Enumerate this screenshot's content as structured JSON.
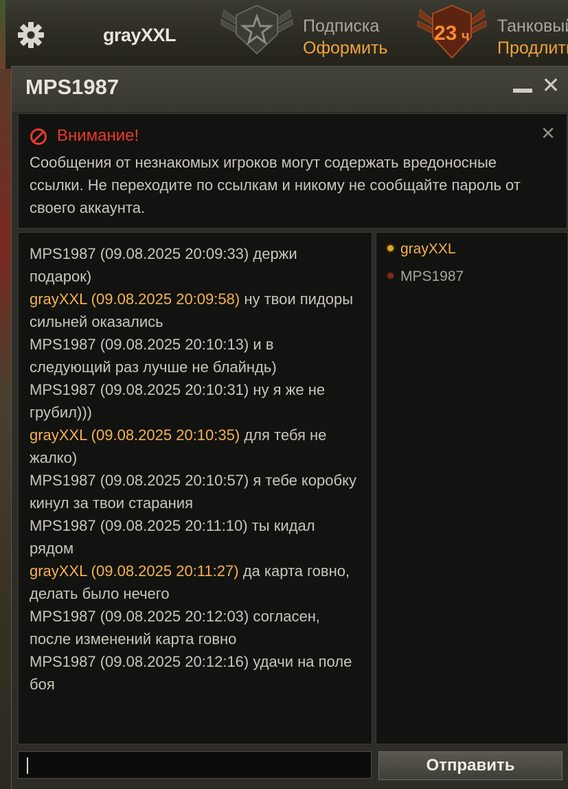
{
  "header": {
    "username": "grayXXL",
    "subscription_label": "Подписка",
    "subscription_action": "Оформить",
    "hours_value": "23",
    "hours_unit": "ч",
    "tank_label": "Танковый",
    "tank_action": "Продлить",
    "accent_color": "#f0a33a"
  },
  "window": {
    "title": "MPS1987"
  },
  "warning": {
    "title": "Внимание!",
    "text": "Сообщения от незнакомых игроков могут содержать вредоносные ссылки. Не переходите по ссылкам и никому не сообщайте пароль от своего аккаунта.",
    "icon": "no-entry-icon",
    "title_color": "#e63a2a"
  },
  "messages": [
    {
      "author_line": "MPS1987 (09.08.2025 20:09:33)",
      "text": "держи подарок)",
      "self": false
    },
    {
      "author_line": "grayXXL (09.08.2025 20:09:58)",
      "text": "ну твои пидоры сильней оказались",
      "self": true
    },
    {
      "author_line": "MPS1987 (09.08.2025 20:10:13)",
      "text": "и в следующий раз лучше не блайндь)",
      "self": false
    },
    {
      "author_line": "MPS1987 (09.08.2025 20:10:31)",
      "text": "ну я же не грубил)))",
      "self": false
    },
    {
      "author_line": "grayXXL (09.08.2025 20:10:35)",
      "text": "для тебя не жалко)",
      "self": true
    },
    {
      "author_line": "MPS1987 (09.08.2025 20:10:57)",
      "text": "я тебе коробку кинул за твои старания",
      "self": false
    },
    {
      "author_line": "MPS1987 (09.08.2025 20:11:10)",
      "text": "ты кидал рядом",
      "self": false
    },
    {
      "author_line": "grayXXL (09.08.2025 20:11:27)",
      "text": "да карта говно, делать было нечего",
      "self": true
    },
    {
      "author_line": "MPS1987 (09.08.2025 20:12:03)",
      "text": "согласен, после изменений карта говно",
      "self": false
    },
    {
      "author_line": "MPS1987 (09.08.2025 20:12:16)",
      "text": "удачи на поле боя",
      "self": false
    }
  ],
  "members": [
    {
      "name": "grayXXL",
      "status": "online"
    },
    {
      "name": "MPS1987",
      "status": "offline"
    }
  ],
  "composer": {
    "value": "",
    "send_label": "Отправить"
  }
}
